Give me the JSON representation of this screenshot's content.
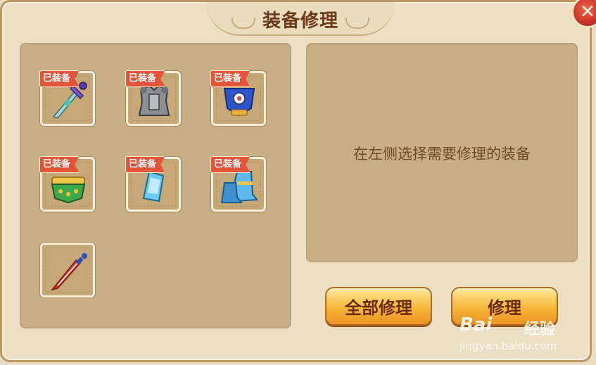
{
  "dialog": {
    "title": "装备修理",
    "close_label": "✕"
  },
  "equipment": {
    "badge": "已装备",
    "items": [
      {
        "name": "sword",
        "equipped": true
      },
      {
        "name": "armor",
        "equipped": true
      },
      {
        "name": "helmet",
        "equipped": true
      },
      {
        "name": "belt",
        "equipped": true
      },
      {
        "name": "bracer",
        "equipped": true
      },
      {
        "name": "boots",
        "equipped": true
      },
      {
        "name": "red-blade",
        "equipped": false
      }
    ]
  },
  "detail": {
    "hint": "在左侧选择需要修理的装备"
  },
  "actions": {
    "repair_all": "全部修理",
    "repair": "修理"
  },
  "watermark": {
    "logo": "Bai",
    "text": "经验",
    "url": "jingyan.baidu.com"
  },
  "colors": {
    "panel": "#c7ae87",
    "badge": "#e4533a",
    "button": "#f8b73a",
    "close": "#c8322a"
  }
}
